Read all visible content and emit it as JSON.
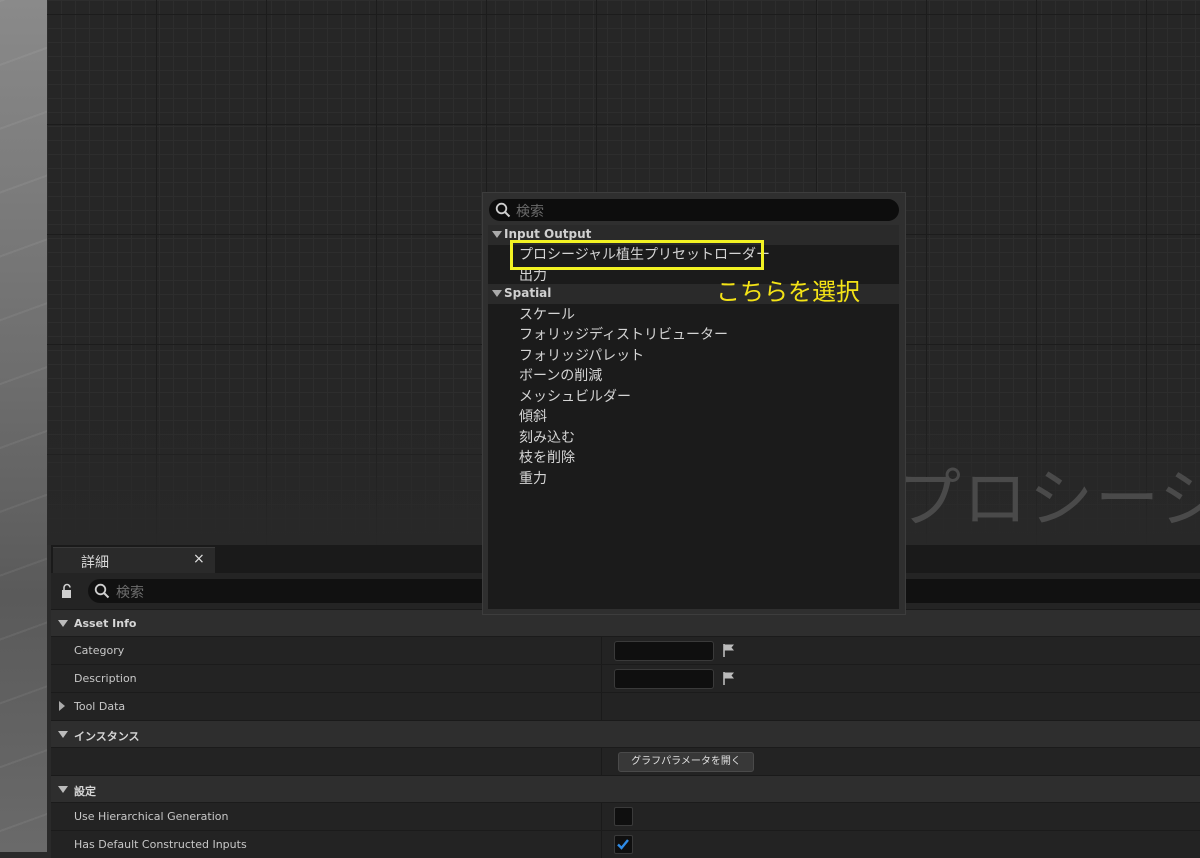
{
  "graph": {
    "watermark_text": "プロシージャ"
  },
  "popup": {
    "search_placeholder": "検索",
    "categories": [
      {
        "label": "Input Output",
        "items": [
          "プロシージャル植生プリセットローダー",
          "出力"
        ]
      },
      {
        "label": "Spatial",
        "items": [
          "スケール",
          "フォリッジディストリビューター",
          "フォリッジパレット",
          "ボーンの削減",
          "メッシュビルダー",
          "傾斜",
          "刻み込む",
          "枝を削除",
          "重力"
        ]
      }
    ],
    "highlight_color": "#f2f223"
  },
  "annotation": {
    "text": "こちらを選択",
    "color": "#f4e316"
  },
  "details": {
    "tab_label": "詳細",
    "tab_close": "×",
    "search_placeholder": "検索",
    "sections": {
      "asset_info": "Asset Info",
      "category_label": "Category",
      "description_label": "Description",
      "tool_data_label": "Tool Data",
      "instance": "インスタンス",
      "open_graph_params_button": "グラフパラメータを開く",
      "settings": "設定",
      "use_hierarchical_label": "Use Hierarchical Generation",
      "use_hierarchical_checked": false,
      "has_default_inputs_label": "Has Default Constructed Inputs",
      "has_default_inputs_checked": true
    }
  }
}
